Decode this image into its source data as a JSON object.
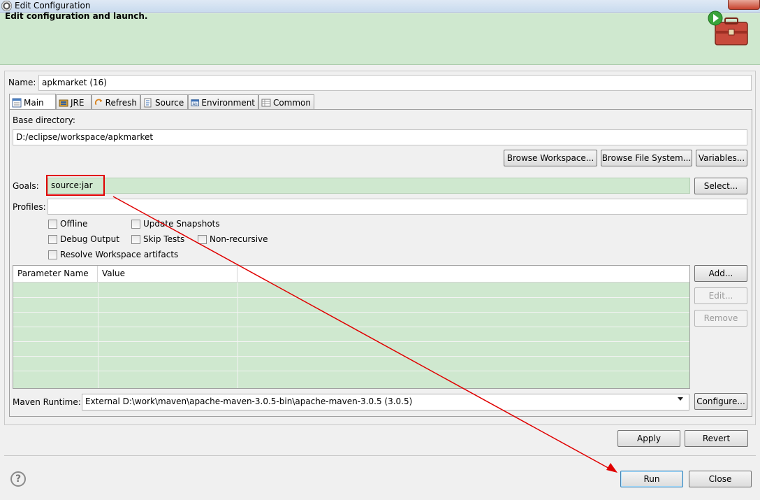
{
  "window": {
    "title": "Edit Configuration"
  },
  "header": {
    "text": "Edit configuration and launch."
  },
  "name_field": {
    "label": "Name:",
    "value": "apkmarket (16)"
  },
  "tabs": [
    {
      "label": "Main",
      "icon": "main-tab-icon",
      "active": true
    },
    {
      "label": "JRE",
      "icon": "jre-icon"
    },
    {
      "label": "Refresh",
      "icon": "refresh-icon"
    },
    {
      "label": "Source",
      "icon": "source-icon"
    },
    {
      "label": "Environment",
      "icon": "environment-icon"
    },
    {
      "label": "Common",
      "icon": "common-icon"
    }
  ],
  "main": {
    "base_dir_label": "Base directory:",
    "base_dir_value": "D:/eclipse/workspace/apkmarket",
    "browse_workspace": "Browse Workspace...",
    "browse_fs": "Browse File System...",
    "variables": "Variables...",
    "goals_label": "Goals:",
    "goals_value": "source:jar",
    "select": "Select...",
    "profiles_label": "Profiles:",
    "profiles_value": "",
    "checkboxes": {
      "offline": "Offline",
      "update_snapshots": "Update Snapshots",
      "debug_output": "Debug Output",
      "skip_tests": "Skip Tests",
      "non_recursive": "Non-recursive",
      "resolve_workspace": "Resolve Workspace artifacts"
    },
    "table": {
      "columns": [
        "Parameter Name",
        "Value"
      ]
    },
    "add": "Add...",
    "edit": "Edit...",
    "remove": "Remove",
    "runtime_label": "Maven Runtime:",
    "runtime_value": "External D:\\work\\maven\\apache-maven-3.0.5-bin\\apache-maven-3.0.5 (3.0.5)",
    "configure": "Configure..."
  },
  "footer": {
    "apply": "Apply",
    "revert": "Revert",
    "run": "Run",
    "close": "Close",
    "help": "?"
  },
  "colors": {
    "header_bg": "#cfe8cf",
    "highlight": "#cfe8cf",
    "annotation": "#e00000"
  }
}
